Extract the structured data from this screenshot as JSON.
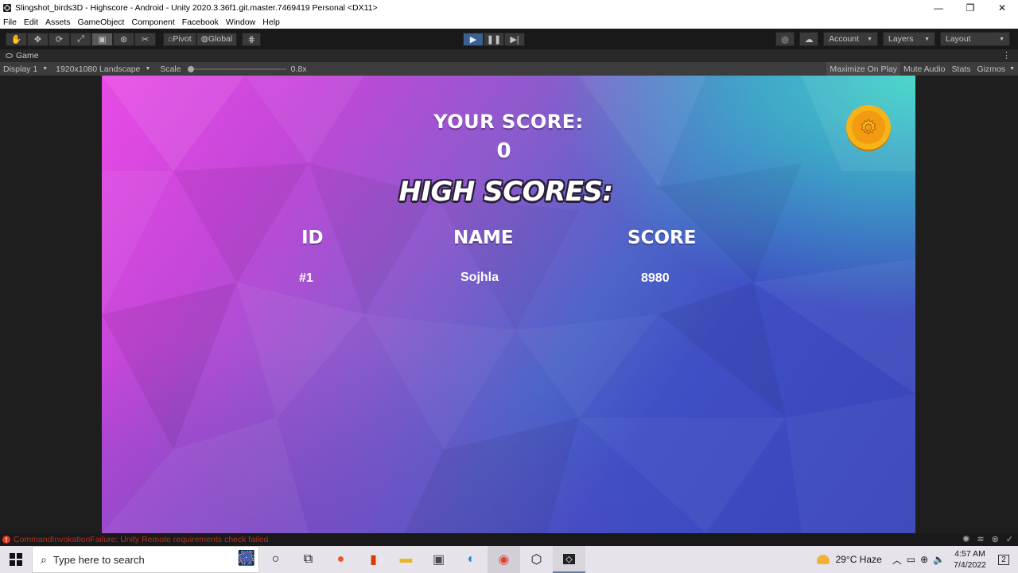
{
  "window": {
    "title": "Slingshot_birds3D - Highscore - Android - Unity 2020.3.36f1.git.master.7469419 Personal <DX11>",
    "controls": [
      "—",
      "❐",
      "✕"
    ]
  },
  "menu": [
    "File",
    "Edit",
    "Assets",
    "GameObject",
    "Component",
    "Facebook",
    "Window",
    "Help"
  ],
  "toolbar": {
    "pivot_label": "Pivot",
    "global_label": "Global",
    "account_label": "Account",
    "layers_label": "Layers",
    "layout_label": "Layout"
  },
  "game_tab": {
    "label": "Game"
  },
  "game_bar": {
    "display": "Display 1",
    "resolution": "1920x1080 Landscape",
    "scale_label": "Scale",
    "scale_value": "0.8x",
    "scale_fraction": 0,
    "maximize": "Maximize On Play",
    "mute": "Mute Audio",
    "stats": "Stats",
    "gizmos": "Gizmos"
  },
  "game": {
    "your_score_label": "YOUR SCORE:",
    "your_score_value": "0",
    "high_scores_title": "HIGH SCORES:",
    "columns": [
      "ID",
      "NAME",
      "SCORE"
    ],
    "rows": [
      {
        "id": "#1",
        "name": "Sojhla",
        "score": "8980"
      }
    ]
  },
  "status": {
    "error_text": "CommandInvokationFailure: Unity Remote requirements check failed"
  },
  "taskbar": {
    "search_placeholder": "Type here to search",
    "weather": "29°C  Haze",
    "time": "4:57 AM",
    "date": "7/4/2022",
    "notification_count": "2"
  },
  "colors": {
    "play_active": "#3b5f8f",
    "error": "#b5311f",
    "gear": "#f7b419"
  }
}
